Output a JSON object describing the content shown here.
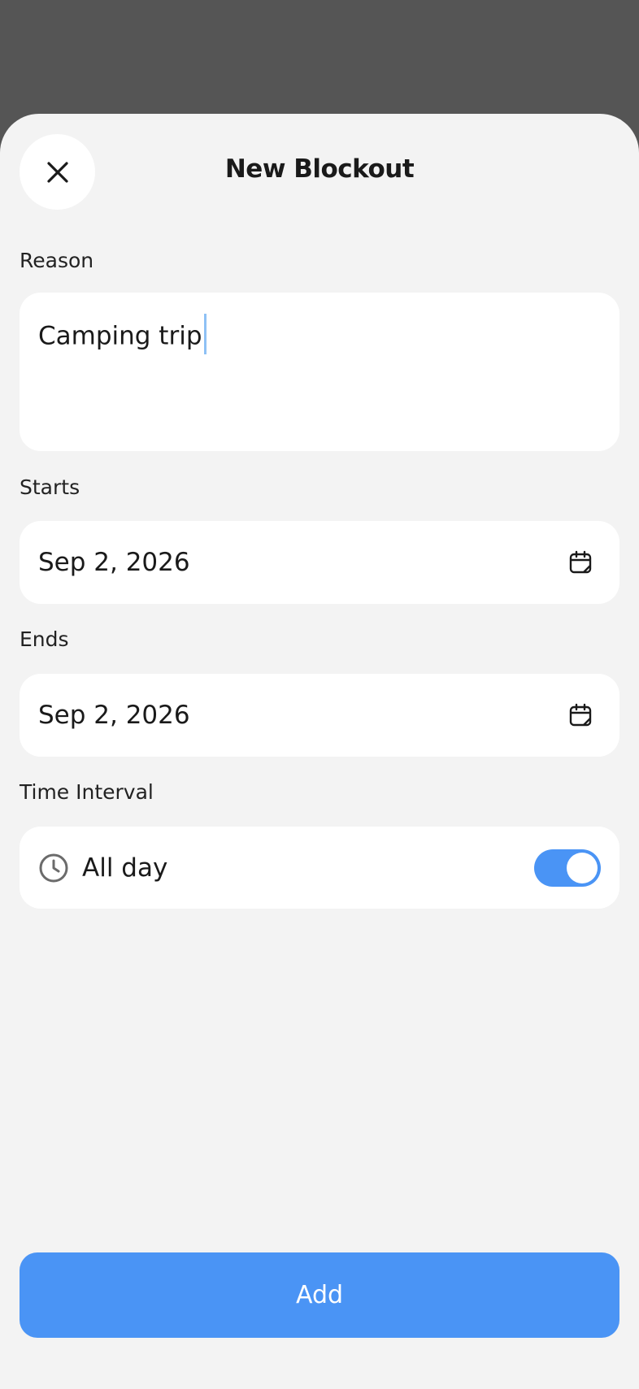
{
  "header": {
    "title": "New Blockout",
    "close_icon": "close-icon"
  },
  "reason": {
    "label": "Reason",
    "value": "Camping trip"
  },
  "starts": {
    "label": "Starts",
    "value": "Sep 2, 2026",
    "icon": "calendar-icon"
  },
  "ends": {
    "label": "Ends",
    "value": "Sep 2, 2026",
    "icon": "calendar-icon"
  },
  "time_interval": {
    "label": "Time Interval",
    "option_label": "All day",
    "icon": "clock-icon",
    "all_day_enabled": true
  },
  "footer": {
    "add_label": "Add"
  },
  "colors": {
    "accent": "#4a94f5",
    "backdrop": "#555555",
    "sheet": "#f3f3f3"
  }
}
